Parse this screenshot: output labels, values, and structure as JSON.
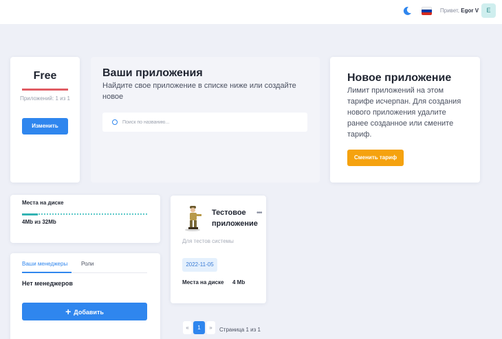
{
  "header": {
    "greeting": "Привет,",
    "user_name": "Egor V",
    "avatar_letter": "E",
    "flag_colors": [
      "#ffffff",
      "#0039a6",
      "#d52b1e"
    ]
  },
  "plan": {
    "name": "Free",
    "apps_usage": "Приложений: 1 из 1",
    "change_button": "Изменить"
  },
  "apps_search": {
    "title": "Ваши приложения",
    "description": "Найдите свое приложение в списке ниже или создайте новое",
    "placeholder": "Поиск по названию..."
  },
  "new_app": {
    "title": "Новое приложение",
    "description": "Лимит приложений на этом тарифе исчерпан. Для создания нового приложения удалите ранее созданное или смените тариф.",
    "button": "Сменить тариф"
  },
  "disk": {
    "title": "Места на диске",
    "value": "4Mb из 32Mb",
    "used_fraction": 0.125
  },
  "managers": {
    "tab_managers": "Ваши менеджеры",
    "tab_roles": "Роли",
    "empty_text": "Нет менеджеров",
    "add_button": "Добавить"
  },
  "app_card": {
    "name": "Тестовое приложение",
    "description": "Для тестов системы",
    "date": "2022-11-05",
    "disk_label": "Места на диске",
    "disk_value": "4 Mb",
    "more_icon": "more-dots-icon"
  },
  "pagination": {
    "prev": "«",
    "current": "1",
    "next": "»",
    "label": "Страница 1 из 1"
  },
  "colors": {
    "accent": "#2f86ee",
    "orange": "#f5a20f",
    "plan_bar": "#e05c63",
    "disk_fill": "#33b3b3"
  }
}
